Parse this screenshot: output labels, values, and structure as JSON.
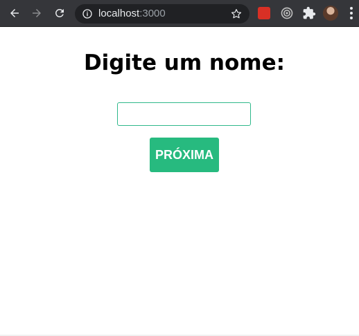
{
  "browser": {
    "url_host": "localhost",
    "url_port": ":3000",
    "icons": {
      "back": "arrow-left-icon",
      "forward": "arrow-right-icon",
      "reload": "reload-icon",
      "site_info": "info-icon",
      "bookmark": "star-icon",
      "extensions": "puzzle-icon",
      "menu": "kebab-menu-icon"
    }
  },
  "page": {
    "title": "Digite um nome:",
    "name_input_value": "",
    "next_button_label": "PRÓXIMA"
  },
  "colors": {
    "accent": "#27ba7f",
    "input_border": "#2eb88a",
    "toolbar": "#35363a"
  }
}
